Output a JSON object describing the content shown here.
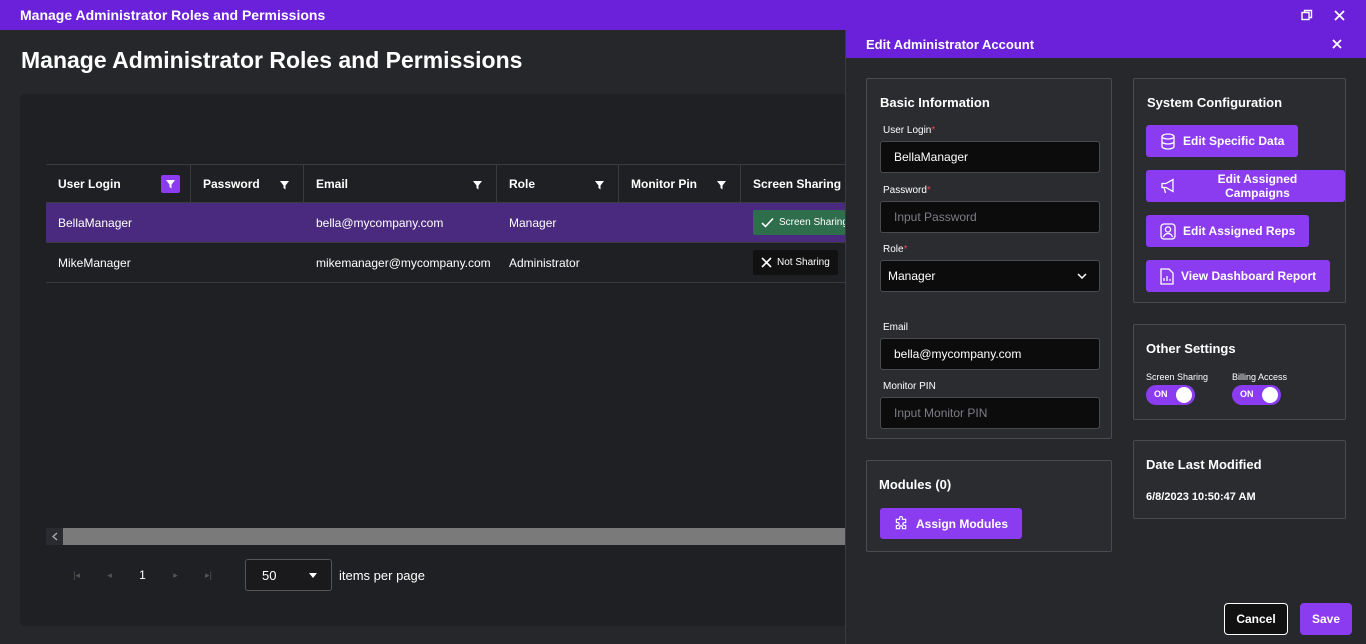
{
  "window": {
    "title": "Manage Administrator Roles and Permissions"
  },
  "page": {
    "title": "Manage Administrator Roles and Permissions"
  },
  "table": {
    "columns": [
      "User Login",
      "Password",
      "Email",
      "Role",
      "Monitor Pin",
      "Screen Sharing"
    ],
    "rows": [
      {
        "user_login": "BellaManager",
        "password": "",
        "email": "bella@mycompany.com",
        "role": "Manager",
        "monitor_pin": "",
        "screen_sharing": "Screen Sharing"
      },
      {
        "user_login": "MikeManager",
        "password": "",
        "email": "mikemanager@mycompany.com",
        "role": "Administrator",
        "monitor_pin": "",
        "screen_sharing": "Not Sharing"
      }
    ]
  },
  "pager": {
    "page": "1",
    "page_size": "50",
    "label": "items per page"
  },
  "panel": {
    "title": "Edit Administrator Account",
    "basic": {
      "heading": "Basic Information",
      "user_login_label": "User Login",
      "user_login_value": "BellaManager",
      "password_label": "Password",
      "password_placeholder": "Input Password",
      "role_label": "Role",
      "role_value": "Manager",
      "email_label": "Email",
      "email_value": "bella@mycompany.com",
      "pin_label": "Monitor PIN",
      "pin_placeholder": "Input Monitor PIN",
      "required_mark": "*"
    },
    "modules": {
      "heading": "Modules (0)",
      "button": "Assign Modules"
    },
    "system": {
      "heading": "System Configuration",
      "buttons": [
        "Edit Specific Data",
        "Edit Assigned Campaigns",
        "Edit Assigned Reps",
        "View Dashboard Report"
      ]
    },
    "other": {
      "heading": "Other Settings",
      "screen_sharing_label": "Screen Sharing",
      "screen_sharing_state": "ON",
      "billing_label": "Billing Access",
      "billing_state": "ON"
    },
    "modified": {
      "heading": "Date Last Modified",
      "value": "6/8/2023 10:50:47 AM"
    },
    "cancel": "Cancel",
    "save": "Save"
  },
  "colors": {
    "accent": "#8b3bf0",
    "titlebar": "#6a21d9",
    "sharing_on": "#2e6e4c",
    "selected_row": "#4a2a7e"
  }
}
